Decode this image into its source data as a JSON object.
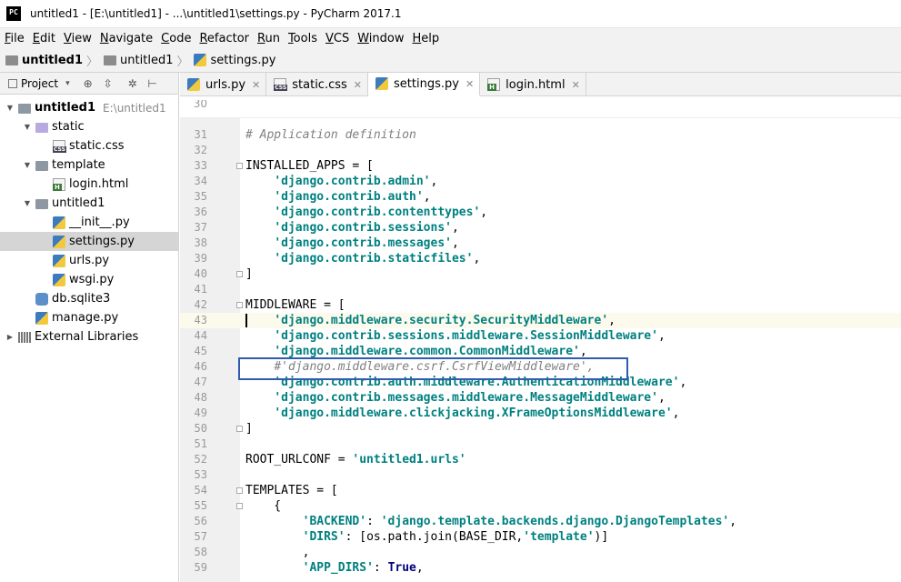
{
  "window": {
    "logo": "PC",
    "title": "untitled1 - [E:\\untitled1] - ...\\untitled1\\settings.py - PyCharm 2017.1"
  },
  "menu": [
    {
      "label": "File",
      "u": "F",
      "rest": "ile"
    },
    {
      "label": "Edit",
      "u": "E",
      "rest": "dit"
    },
    {
      "label": "View",
      "u": "V",
      "rest": "iew"
    },
    {
      "label": "Navigate",
      "u": "N",
      "rest": "avigate"
    },
    {
      "label": "Code",
      "u": "C",
      "rest": "ode"
    },
    {
      "label": "Refactor",
      "u": "R",
      "rest": "efactor"
    },
    {
      "label": "Run",
      "u": "R",
      "rest": "un"
    },
    {
      "label": "Tools",
      "u": "T",
      "rest": "ools"
    },
    {
      "label": "VCS",
      "u": "V",
      "rest": "CS"
    },
    {
      "label": "Window",
      "u": "W",
      "rest": "indow"
    },
    {
      "label": "Help",
      "u": "H",
      "rest": "elp"
    }
  ],
  "breadcrumb": [
    "untitled1",
    "untitled1",
    "settings.py"
  ],
  "project_panel": {
    "title": "Project",
    "tree": [
      {
        "label": "untitled1",
        "hint": "E:\\untitled1",
        "depth": 0,
        "icon": "folder",
        "expanded": true,
        "bold": true
      },
      {
        "label": "static",
        "depth": 1,
        "icon": "folder-lilac",
        "expanded": true
      },
      {
        "label": "static.css",
        "depth": 2,
        "icon": "file-css"
      },
      {
        "label": "template",
        "depth": 1,
        "icon": "folder",
        "expanded": true
      },
      {
        "label": "login.html",
        "depth": 2,
        "icon": "file-html"
      },
      {
        "label": "untitled1",
        "depth": 1,
        "icon": "folder",
        "expanded": true
      },
      {
        "label": "__init__.py",
        "depth": 2,
        "icon": "file-py"
      },
      {
        "label": "settings.py",
        "depth": 2,
        "icon": "file-py",
        "selected": true
      },
      {
        "label": "urls.py",
        "depth": 2,
        "icon": "file-py"
      },
      {
        "label": "wsgi.py",
        "depth": 2,
        "icon": "file-py"
      },
      {
        "label": "db.sqlite3",
        "depth": 1,
        "icon": "db"
      },
      {
        "label": "manage.py",
        "depth": 1,
        "icon": "file-py"
      },
      {
        "label": "External Libraries",
        "depth": 0,
        "icon": "lib",
        "expanded": false
      }
    ]
  },
  "tabs": [
    {
      "label": "urls.py",
      "icon": "file-py"
    },
    {
      "label": "static.css",
      "icon": "file-css"
    },
    {
      "label": "settings.py",
      "icon": "file-py",
      "active": true
    },
    {
      "label": "login.html",
      "icon": "file-html"
    }
  ],
  "editor": {
    "partial_top_line": "30",
    "current_line": 43,
    "lines": [
      {
        "n": "31",
        "parts": [
          [
            "c",
            "# Application definition"
          ]
        ]
      },
      {
        "n": "32",
        "parts": []
      },
      {
        "n": "33",
        "parts": [
          [
            "p",
            "INSTALLED_APPS = ["
          ]
        ],
        "fold": true
      },
      {
        "n": "34",
        "parts": [
          [
            "p",
            "    "
          ],
          [
            "s",
            "'django.contrib.admin'"
          ],
          [
            "p",
            ","
          ]
        ]
      },
      {
        "n": "35",
        "parts": [
          [
            "p",
            "    "
          ],
          [
            "s",
            "'django.contrib.auth'"
          ],
          [
            "p",
            ","
          ]
        ]
      },
      {
        "n": "36",
        "parts": [
          [
            "p",
            "    "
          ],
          [
            "s",
            "'django.contrib.contenttypes'"
          ],
          [
            "p",
            ","
          ]
        ]
      },
      {
        "n": "37",
        "parts": [
          [
            "p",
            "    "
          ],
          [
            "s",
            "'django.contrib.sessions'"
          ],
          [
            "p",
            ","
          ]
        ]
      },
      {
        "n": "38",
        "parts": [
          [
            "p",
            "    "
          ],
          [
            "s",
            "'django.contrib.messages'"
          ],
          [
            "p",
            ","
          ]
        ]
      },
      {
        "n": "39",
        "parts": [
          [
            "p",
            "    "
          ],
          [
            "s",
            "'django.contrib.staticfiles'"
          ],
          [
            "p",
            ","
          ]
        ]
      },
      {
        "n": "40",
        "parts": [
          [
            "p",
            "]"
          ]
        ],
        "fold": true
      },
      {
        "n": "41",
        "parts": []
      },
      {
        "n": "42",
        "parts": [
          [
            "p",
            "MIDDLEWARE = ["
          ]
        ],
        "fold": true
      },
      {
        "n": "43",
        "parts": [
          [
            "p",
            "    "
          ],
          [
            "s",
            "'django.middleware.security.SecurityMiddleware'"
          ],
          [
            "p",
            ","
          ]
        ]
      },
      {
        "n": "44",
        "parts": [
          [
            "p",
            "    "
          ],
          [
            "s",
            "'django.contrib.sessions.middleware.SessionMiddleware'"
          ],
          [
            "p",
            ","
          ]
        ]
      },
      {
        "n": "45",
        "parts": [
          [
            "p",
            "    "
          ],
          [
            "s",
            "'django.middleware.common.CommonMiddleware'"
          ],
          [
            "p",
            ","
          ]
        ]
      },
      {
        "n": "46",
        "parts": [
          [
            "p",
            "    "
          ],
          [
            "c",
            "#'django.middleware.csrf.CsrfViewMiddleware',"
          ]
        ]
      },
      {
        "n": "47",
        "parts": [
          [
            "p",
            "    "
          ],
          [
            "s",
            "'django.contrib.auth.middleware.AuthenticationMiddleware'"
          ],
          [
            "p",
            ","
          ]
        ]
      },
      {
        "n": "48",
        "parts": [
          [
            "p",
            "    "
          ],
          [
            "s",
            "'django.contrib.messages.middleware.MessageMiddleware'"
          ],
          [
            "p",
            ","
          ]
        ]
      },
      {
        "n": "49",
        "parts": [
          [
            "p",
            "    "
          ],
          [
            "s",
            "'django.middleware.clickjacking.XFrameOptionsMiddleware'"
          ],
          [
            "p",
            ","
          ]
        ]
      },
      {
        "n": "50",
        "parts": [
          [
            "p",
            "]"
          ]
        ],
        "fold": true
      },
      {
        "n": "51",
        "parts": []
      },
      {
        "n": "52",
        "parts": [
          [
            "p",
            "ROOT_URLCONF = "
          ],
          [
            "s",
            "'untitled1.urls'"
          ]
        ]
      },
      {
        "n": "53",
        "parts": []
      },
      {
        "n": "54",
        "parts": [
          [
            "p",
            "TEMPLATES = ["
          ]
        ],
        "fold": true
      },
      {
        "n": "55",
        "parts": [
          [
            "p",
            "    {"
          ]
        ],
        "fold": true
      },
      {
        "n": "56",
        "parts": [
          [
            "p",
            "        "
          ],
          [
            "s",
            "'BACKEND'"
          ],
          [
            "p",
            ": "
          ],
          [
            "s",
            "'django.template.backends.django.DjangoTemplates'"
          ],
          [
            "p",
            ","
          ]
        ]
      },
      {
        "n": "57",
        "parts": [
          [
            "p",
            "        "
          ],
          [
            "s",
            "'DIRS'"
          ],
          [
            "p",
            ": [os.path.join(BASE_DIR,"
          ],
          [
            "s",
            "'template'"
          ],
          [
            "p",
            ")]"
          ]
        ]
      },
      {
        "n": "58",
        "parts": [
          [
            "p",
            "        ,"
          ]
        ]
      },
      {
        "n": "59",
        "parts": [
          [
            "p",
            "        "
          ],
          [
            "s",
            "'APP_DIRS'"
          ],
          [
            "p",
            ": "
          ],
          [
            "k",
            "True"
          ],
          [
            "p",
            ","
          ]
        ]
      }
    ]
  },
  "annotation": {
    "highlighted_line": "46",
    "color": "#2f5bb0"
  }
}
